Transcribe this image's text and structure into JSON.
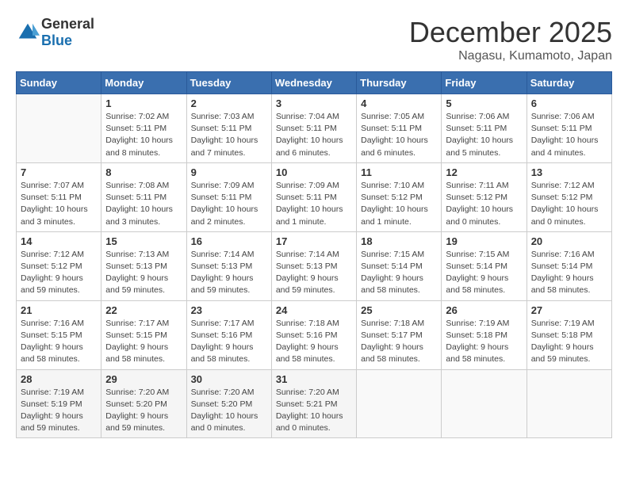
{
  "header": {
    "logo_general": "General",
    "logo_blue": "Blue",
    "title": "December 2025",
    "location": "Nagasu, Kumamoto, Japan"
  },
  "calendar": {
    "columns": [
      "Sunday",
      "Monday",
      "Tuesday",
      "Wednesday",
      "Thursday",
      "Friday",
      "Saturday"
    ],
    "weeks": [
      [
        {
          "day": "",
          "info": ""
        },
        {
          "day": "1",
          "info": "Sunrise: 7:02 AM\nSunset: 5:11 PM\nDaylight: 10 hours\nand 8 minutes."
        },
        {
          "day": "2",
          "info": "Sunrise: 7:03 AM\nSunset: 5:11 PM\nDaylight: 10 hours\nand 7 minutes."
        },
        {
          "day": "3",
          "info": "Sunrise: 7:04 AM\nSunset: 5:11 PM\nDaylight: 10 hours\nand 6 minutes."
        },
        {
          "day": "4",
          "info": "Sunrise: 7:05 AM\nSunset: 5:11 PM\nDaylight: 10 hours\nand 6 minutes."
        },
        {
          "day": "5",
          "info": "Sunrise: 7:06 AM\nSunset: 5:11 PM\nDaylight: 10 hours\nand 5 minutes."
        },
        {
          "day": "6",
          "info": "Sunrise: 7:06 AM\nSunset: 5:11 PM\nDaylight: 10 hours\nand 4 minutes."
        }
      ],
      [
        {
          "day": "7",
          "info": "Sunrise: 7:07 AM\nSunset: 5:11 PM\nDaylight: 10 hours\nand 3 minutes."
        },
        {
          "day": "8",
          "info": "Sunrise: 7:08 AM\nSunset: 5:11 PM\nDaylight: 10 hours\nand 3 minutes."
        },
        {
          "day": "9",
          "info": "Sunrise: 7:09 AM\nSunset: 5:11 PM\nDaylight: 10 hours\nand 2 minutes."
        },
        {
          "day": "10",
          "info": "Sunrise: 7:09 AM\nSunset: 5:11 PM\nDaylight: 10 hours\nand 1 minute."
        },
        {
          "day": "11",
          "info": "Sunrise: 7:10 AM\nSunset: 5:12 PM\nDaylight: 10 hours\nand 1 minute."
        },
        {
          "day": "12",
          "info": "Sunrise: 7:11 AM\nSunset: 5:12 PM\nDaylight: 10 hours\nand 0 minutes."
        },
        {
          "day": "13",
          "info": "Sunrise: 7:12 AM\nSunset: 5:12 PM\nDaylight: 10 hours\nand 0 minutes."
        }
      ],
      [
        {
          "day": "14",
          "info": "Sunrise: 7:12 AM\nSunset: 5:12 PM\nDaylight: 9 hours\nand 59 minutes."
        },
        {
          "day": "15",
          "info": "Sunrise: 7:13 AM\nSunset: 5:13 PM\nDaylight: 9 hours\nand 59 minutes."
        },
        {
          "day": "16",
          "info": "Sunrise: 7:14 AM\nSunset: 5:13 PM\nDaylight: 9 hours\nand 59 minutes."
        },
        {
          "day": "17",
          "info": "Sunrise: 7:14 AM\nSunset: 5:13 PM\nDaylight: 9 hours\nand 59 minutes."
        },
        {
          "day": "18",
          "info": "Sunrise: 7:15 AM\nSunset: 5:14 PM\nDaylight: 9 hours\nand 58 minutes."
        },
        {
          "day": "19",
          "info": "Sunrise: 7:15 AM\nSunset: 5:14 PM\nDaylight: 9 hours\nand 58 minutes."
        },
        {
          "day": "20",
          "info": "Sunrise: 7:16 AM\nSunset: 5:14 PM\nDaylight: 9 hours\nand 58 minutes."
        }
      ],
      [
        {
          "day": "21",
          "info": "Sunrise: 7:16 AM\nSunset: 5:15 PM\nDaylight: 9 hours\nand 58 minutes."
        },
        {
          "day": "22",
          "info": "Sunrise: 7:17 AM\nSunset: 5:15 PM\nDaylight: 9 hours\nand 58 minutes."
        },
        {
          "day": "23",
          "info": "Sunrise: 7:17 AM\nSunset: 5:16 PM\nDaylight: 9 hours\nand 58 minutes."
        },
        {
          "day": "24",
          "info": "Sunrise: 7:18 AM\nSunset: 5:16 PM\nDaylight: 9 hours\nand 58 minutes."
        },
        {
          "day": "25",
          "info": "Sunrise: 7:18 AM\nSunset: 5:17 PM\nDaylight: 9 hours\nand 58 minutes."
        },
        {
          "day": "26",
          "info": "Sunrise: 7:19 AM\nSunset: 5:18 PM\nDaylight: 9 hours\nand 58 minutes."
        },
        {
          "day": "27",
          "info": "Sunrise: 7:19 AM\nSunset: 5:18 PM\nDaylight: 9 hours\nand 59 minutes."
        }
      ],
      [
        {
          "day": "28",
          "info": "Sunrise: 7:19 AM\nSunset: 5:19 PM\nDaylight: 9 hours\nand 59 minutes."
        },
        {
          "day": "29",
          "info": "Sunrise: 7:20 AM\nSunset: 5:20 PM\nDaylight: 9 hours\nand 59 minutes."
        },
        {
          "day": "30",
          "info": "Sunrise: 7:20 AM\nSunset: 5:20 PM\nDaylight: 10 hours\nand 0 minutes."
        },
        {
          "day": "31",
          "info": "Sunrise: 7:20 AM\nSunset: 5:21 PM\nDaylight: 10 hours\nand 0 minutes."
        },
        {
          "day": "",
          "info": ""
        },
        {
          "day": "",
          "info": ""
        },
        {
          "day": "",
          "info": ""
        }
      ]
    ]
  }
}
